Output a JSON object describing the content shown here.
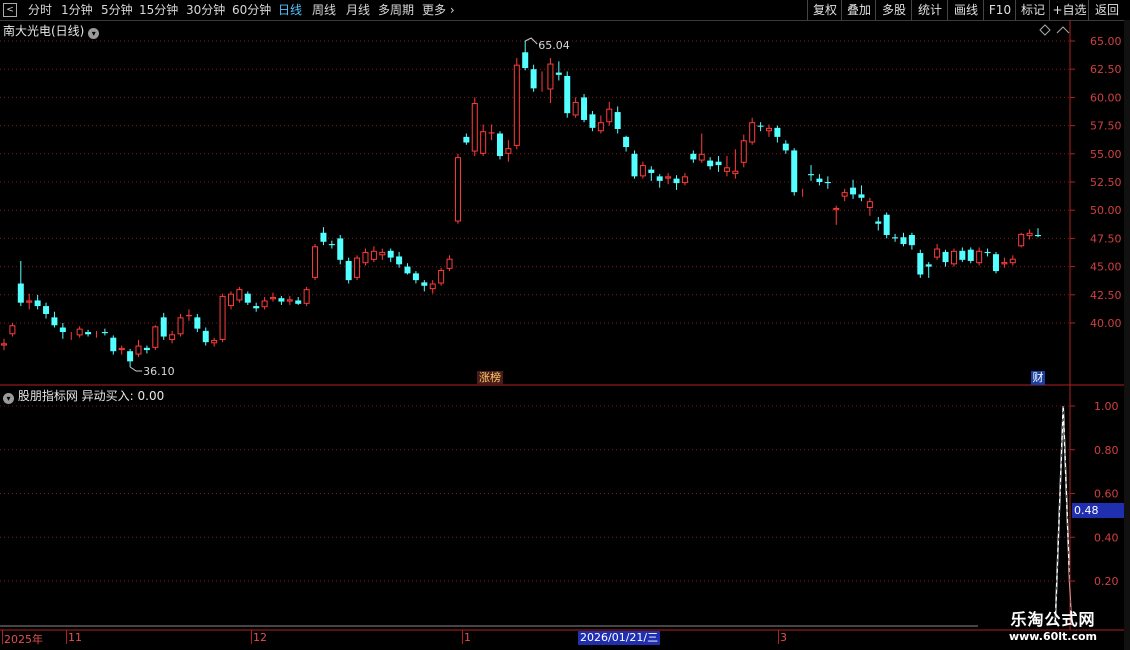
{
  "toolbar": {
    "periods": [
      "分时",
      "1分钟",
      "5分钟",
      "15分钟",
      "30分钟",
      "60分钟",
      "日线",
      "周线",
      "月线",
      "多周期",
      "更多"
    ],
    "active_period": "日线",
    "right_buttons": [
      "复权",
      "叠加",
      "多股",
      "统计",
      "画线",
      "F10",
      "标记",
      "+自选",
      "返回"
    ]
  },
  "main_chart": {
    "title": "南大光电(日线)",
    "high_label": "65.04",
    "low_label": "36.10",
    "badge_left": "涨榜",
    "badge_right": "财"
  },
  "indicator": {
    "title": "股朋指标网 异动买入: 0.00",
    "current_value": "0.48"
  },
  "time_axis": {
    "labels": [
      "2025年",
      "11",
      "12",
      "1",
      "3"
    ],
    "cursor_date": "2026/01/21/三"
  },
  "watermark": {
    "line1": "乐淘公式网",
    "line2": "www.60lt.com"
  },
  "colors": {
    "up": "#ff3b3b",
    "down": "#54ffff",
    "grid": "#7a1a1a",
    "axis": "#b02020"
  },
  "chart_data": [
    {
      "type": "candlestick",
      "title": "南大光电(日线)",
      "y_ticks": [
        "65.00",
        "62.50",
        "60.00",
        "57.50",
        "55.00",
        "52.50",
        "50.00",
        "47.50",
        "45.00",
        "42.50",
        "40.00"
      ],
      "ylim": [
        37,
        65.5
      ],
      "candles": [
        [
          38.0,
          38.6,
          37.6,
          38.2
        ],
        [
          39.0,
          40.0,
          38.8,
          39.8
        ],
        [
          43.5,
          45.5,
          41.5,
          41.8
        ],
        [
          41.8,
          42.6,
          41.2,
          42.0
        ],
        [
          42.0,
          42.5,
          41.2,
          41.5
        ],
        [
          41.5,
          41.8,
          40.4,
          40.8
        ],
        [
          40.5,
          41.0,
          39.6,
          39.8
        ],
        [
          39.6,
          40.0,
          38.6,
          39.2
        ],
        [
          38.8,
          39.2,
          38.5,
          38.8
        ],
        [
          38.9,
          39.7,
          38.7,
          39.5
        ],
        [
          39.2,
          39.4,
          38.8,
          39.0
        ],
        [
          39.0,
          39.3,
          38.7,
          39.0
        ],
        [
          39.2,
          39.5,
          38.9,
          39.1
        ],
        [
          38.7,
          38.9,
          37.2,
          37.5
        ],
        [
          37.6,
          38.0,
          37.2,
          37.8
        ],
        [
          37.5,
          37.7,
          36.1,
          36.6
        ],
        [
          37.2,
          38.5,
          37.0,
          38.0
        ],
        [
          37.8,
          38.0,
          37.3,
          37.6
        ],
        [
          37.8,
          39.8,
          37.6,
          39.7
        ],
        [
          40.5,
          40.9,
          38.5,
          38.8
        ],
        [
          38.5,
          39.3,
          38.2,
          39.0
        ],
        [
          39.0,
          40.8,
          38.8,
          40.5
        ],
        [
          40.6,
          41.2,
          40.2,
          40.7
        ],
        [
          40.5,
          40.8,
          39.2,
          39.5
        ],
        [
          39.3,
          39.6,
          38.0,
          38.3
        ],
        [
          38.2,
          38.7,
          37.9,
          38.5
        ],
        [
          38.5,
          42.6,
          38.3,
          42.4
        ],
        [
          41.5,
          42.8,
          41.2,
          42.6
        ],
        [
          42.0,
          43.2,
          41.8,
          43.0
        ],
        [
          42.6,
          42.8,
          41.6,
          41.8
        ],
        [
          41.5,
          41.8,
          41.0,
          41.3
        ],
        [
          41.4,
          42.3,
          41.2,
          42.0
        ],
        [
          42.1,
          42.7,
          41.9,
          42.3
        ],
        [
          42.2,
          42.4,
          41.6,
          41.9
        ],
        [
          41.9,
          42.4,
          41.6,
          42.1
        ],
        [
          42.0,
          42.3,
          41.6,
          41.7
        ],
        [
          41.7,
          43.2,
          41.5,
          43.0
        ],
        [
          44.0,
          47.0,
          43.8,
          46.8
        ],
        [
          48.0,
          48.5,
          46.9,
          47.2
        ],
        [
          47.0,
          47.3,
          46.6,
          46.9
        ],
        [
          47.5,
          47.8,
          45.2,
          45.6
        ],
        [
          45.5,
          45.8,
          43.5,
          43.8
        ],
        [
          44.0,
          46.0,
          43.8,
          45.8
        ],
        [
          45.3,
          46.6,
          45.1,
          46.3
        ],
        [
          45.6,
          46.8,
          45.4,
          46.4
        ],
        [
          46.0,
          46.6,
          45.6,
          46.3
        ],
        [
          46.4,
          46.6,
          45.4,
          45.8
        ],
        [
          45.9,
          46.3,
          44.9,
          45.2
        ],
        [
          45.0,
          45.3,
          44.3,
          44.4
        ],
        [
          44.4,
          44.6,
          43.5,
          43.8
        ],
        [
          43.6,
          43.8,
          42.8,
          43.3
        ],
        [
          43.0,
          43.8,
          42.6,
          43.5
        ],
        [
          43.5,
          44.9,
          43.3,
          44.7
        ],
        [
          44.8,
          46.0,
          44.6,
          45.7
        ],
        [
          49.0,
          55.0,
          48.8,
          54.7
        ],
        [
          56.5,
          56.8,
          55.8,
          56.0
        ],
        [
          55.2,
          60.0,
          54.8,
          59.5
        ],
        [
          55.0,
          57.6,
          54.8,
          57.0
        ],
        [
          56.8,
          57.6,
          56.2,
          56.9
        ],
        [
          56.8,
          57.0,
          54.5,
          54.8
        ],
        [
          55.0,
          56.2,
          54.3,
          55.5
        ],
        [
          55.7,
          63.5,
          55.4,
          62.9
        ],
        [
          64.0,
          65.0,
          62.4,
          62.6
        ],
        [
          62.5,
          62.9,
          60.5,
          60.8
        ],
        [
          60.8,
          62.3,
          60.5,
          60.8
        ],
        [
          60.7,
          63.5,
          59.5,
          63.0
        ],
        [
          62.2,
          63.2,
          61.5,
          62.0
        ],
        [
          61.9,
          62.3,
          58.2,
          58.6
        ],
        [
          58.4,
          60.0,
          58.2,
          59.6
        ],
        [
          60.0,
          60.3,
          57.8,
          58.0
        ],
        [
          58.5,
          58.8,
          57.0,
          57.3
        ],
        [
          57.0,
          58.4,
          56.8,
          57.8
        ],
        [
          57.8,
          59.6,
          57.5,
          59.0
        ],
        [
          58.7,
          59.2,
          56.8,
          57.2
        ],
        [
          56.5,
          56.6,
          55.2,
          55.6
        ],
        [
          55.0,
          55.3,
          52.8,
          53.0
        ],
        [
          53.0,
          54.3,
          52.8,
          54.0
        ],
        [
          53.6,
          53.9,
          52.6,
          53.3
        ],
        [
          53.0,
          53.2,
          52.0,
          52.6
        ],
        [
          52.8,
          53.3,
          52.3,
          53.0
        ],
        [
          52.8,
          53.1,
          51.8,
          52.4
        ],
        [
          52.4,
          53.3,
          52.2,
          53.0
        ],
        [
          55.0,
          55.3,
          54.2,
          54.5
        ],
        [
          54.4,
          56.8,
          54.2,
          55.0
        ],
        [
          54.4,
          54.7,
          53.6,
          53.9
        ],
        [
          54.3,
          54.8,
          53.4,
          54.0
        ],
        [
          53.4,
          54.8,
          53.0,
          53.8
        ],
        [
          53.2,
          55.4,
          52.8,
          53.5
        ],
        [
          54.2,
          56.7,
          53.8,
          56.2
        ],
        [
          56.0,
          58.2,
          55.8,
          57.8
        ],
        [
          57.5,
          57.8,
          57.0,
          57.4
        ],
        [
          57.0,
          57.6,
          56.5,
          57.3
        ],
        [
          57.3,
          57.5,
          56.0,
          56.5
        ],
        [
          55.9,
          56.2,
          55.0,
          55.3
        ],
        [
          55.3,
          55.5,
          51.3,
          51.6
        ],
        [
          51.6,
          51.9,
          51.2,
          51.6
        ],
        [
          53.2,
          54.0,
          52.6,
          53.1
        ],
        [
          52.8,
          53.2,
          52.2,
          52.5
        ],
        [
          52.5,
          53.0,
          51.9,
          52.4
        ],
        [
          50.0,
          50.4,
          48.7,
          50.2
        ],
        [
          51.2,
          51.9,
          50.8,
          51.6
        ],
        [
          52.0,
          52.7,
          51.0,
          51.4
        ],
        [
          51.4,
          52.2,
          50.8,
          51.1
        ],
        [
          50.2,
          51.1,
          49.5,
          50.8
        ],
        [
          49.0,
          49.4,
          48.2,
          48.8
        ],
        [
          49.6,
          49.8,
          47.5,
          47.8
        ],
        [
          47.6,
          47.9,
          47.2,
          47.5
        ],
        [
          47.6,
          48.0,
          46.8,
          47.0
        ],
        [
          47.8,
          48.0,
          46.5,
          46.9
        ],
        [
          46.2,
          46.5,
          44.0,
          44.3
        ],
        [
          45.2,
          45.4,
          44.0,
          45.0
        ],
        [
          45.8,
          47.0,
          45.6,
          46.6
        ],
        [
          46.3,
          46.5,
          45.0,
          45.4
        ],
        [
          45.2,
          46.6,
          45.0,
          46.4
        ],
        [
          46.4,
          46.7,
          45.4,
          45.6
        ],
        [
          46.5,
          46.7,
          45.3,
          45.5
        ],
        [
          45.3,
          46.7,
          45.1,
          46.4
        ],
        [
          46.3,
          46.6,
          45.9,
          46.2
        ],
        [
          46.1,
          46.3,
          44.4,
          44.6
        ],
        [
          45.2,
          45.8,
          44.9,
          45.4
        ],
        [
          45.3,
          46.0,
          45.1,
          45.7
        ],
        [
          46.8,
          48.0,
          46.7,
          47.9
        ],
        [
          47.7,
          48.3,
          47.4,
          48.0
        ],
        [
          47.8,
          48.4,
          47.6,
          47.7
        ]
      ]
    },
    {
      "type": "line",
      "title": "股朋指标网 异动买入: 0.00",
      "y_ticks": [
        "1.00",
        "0.80",
        "0.60",
        "0.40",
        "0.20"
      ],
      "ylim": [
        0,
        1.07
      ],
      "x_index_peak": 126,
      "values": [
        0,
        1.0,
        0.48
      ]
    }
  ]
}
